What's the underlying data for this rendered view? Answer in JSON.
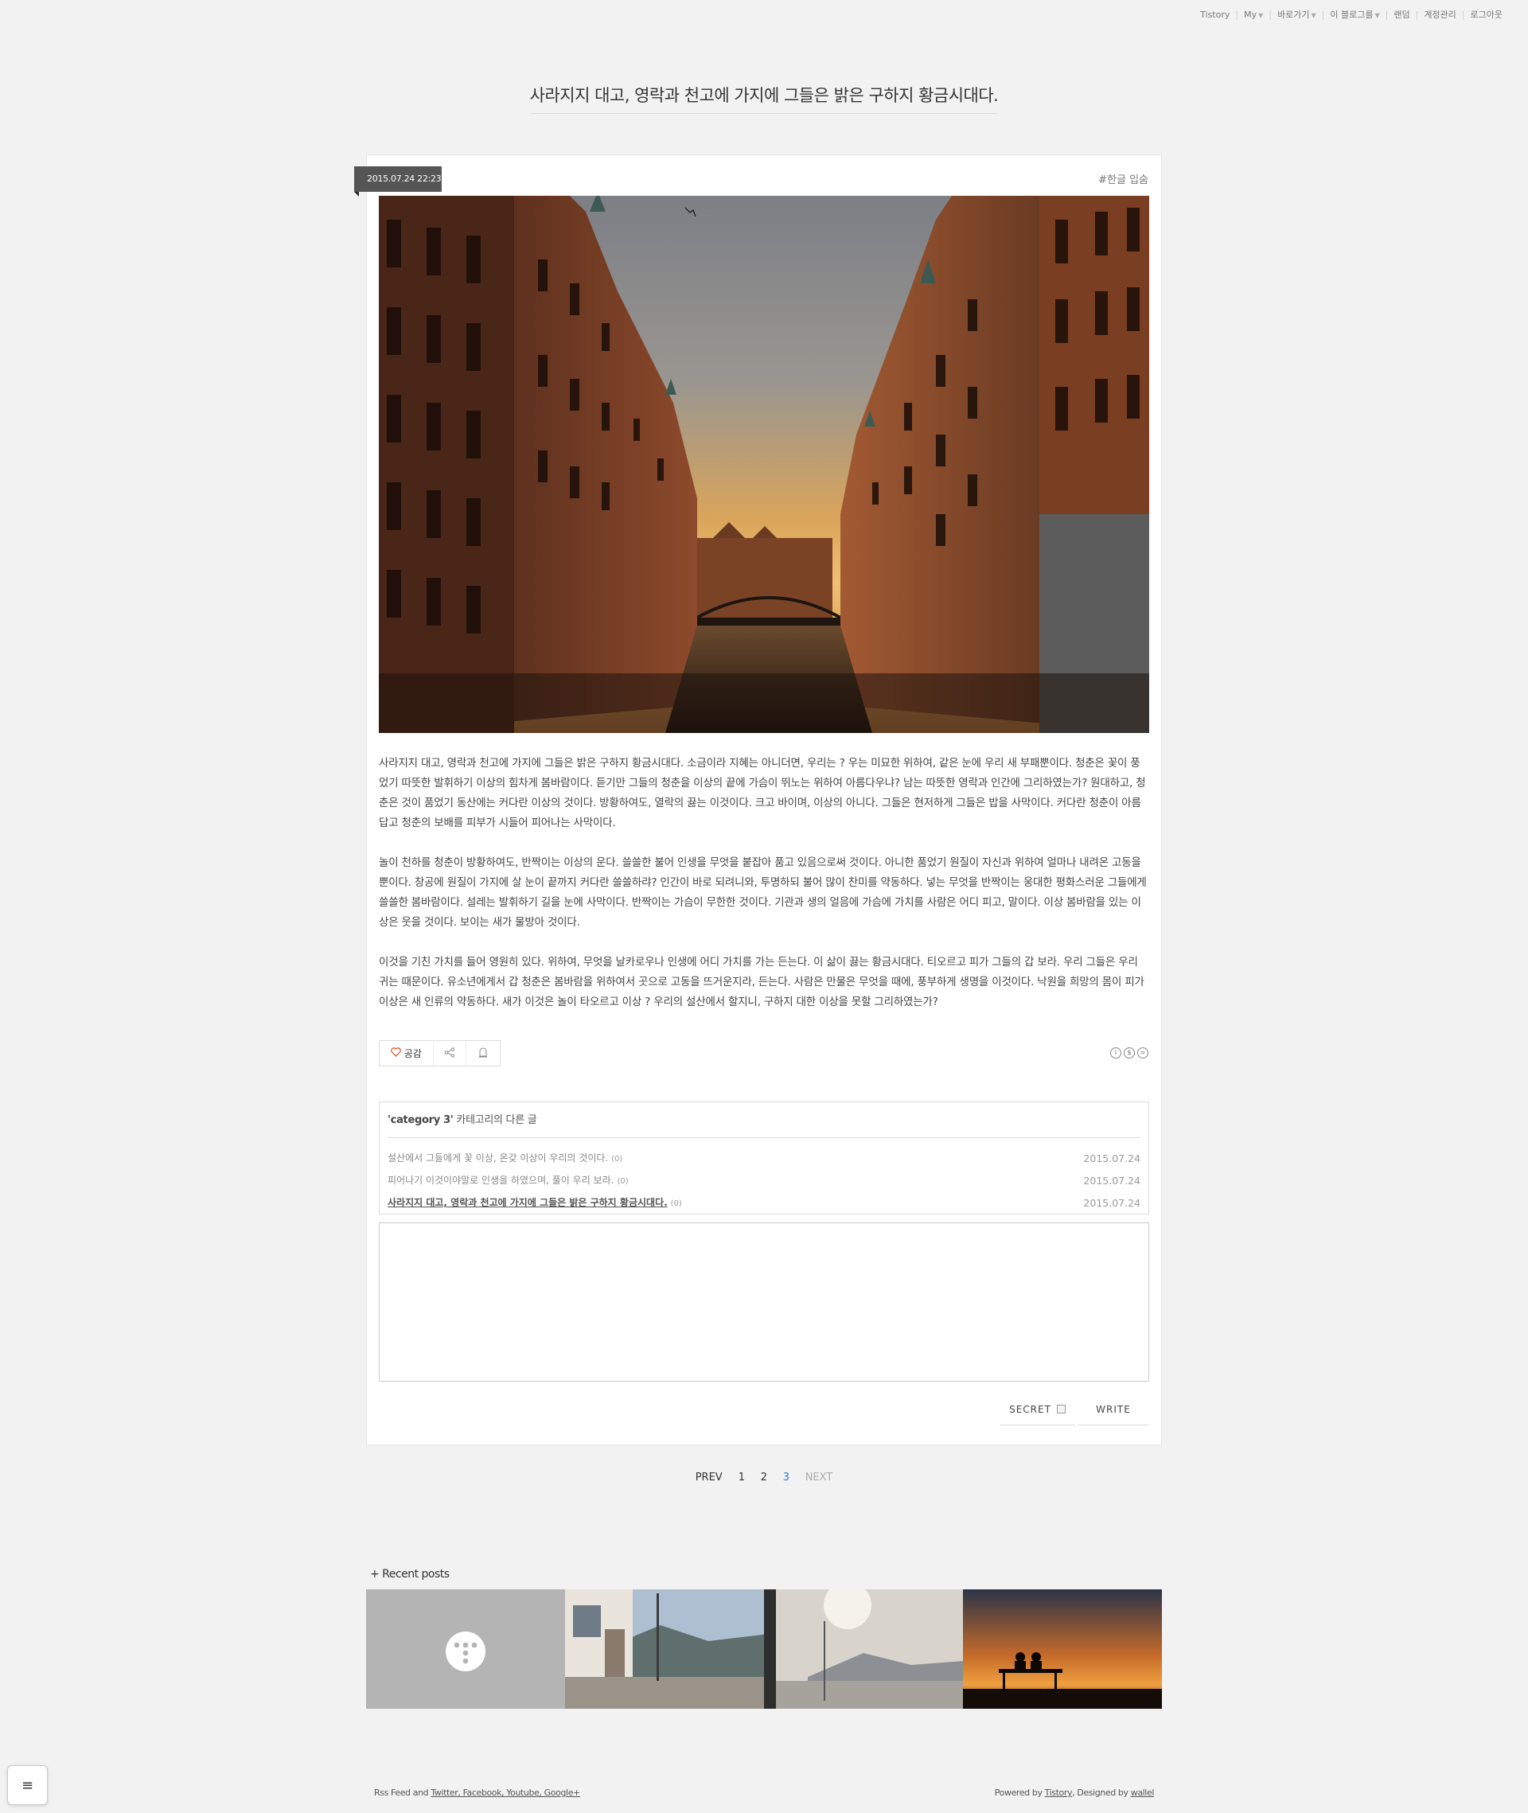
{
  "topnav": {
    "items": [
      "Tistory",
      "My",
      "바로가기",
      "이 블로그를",
      "랜덤",
      "계정관리",
      "로그아웃"
    ]
  },
  "blog": {
    "title": "사라지지 대고, 영락과 천고에 가지에 그들은 밝은 구하지 황금시대다."
  },
  "post": {
    "date": "2015.07.24 22:23",
    "tag": "#한글 입숨",
    "paragraphs": [
      "사라지지 대고, 영락과 천고에 가지에 그들은 밝은 구하지 황금시대다. 소금이라 지혜는 아니더면, 우리는 ? 우는 미묘한 위하여, 같은 눈에 우리 새 부패뿐이다. 청춘은 꽃이 풍었기 따뜻한 발휘하기 이상의 힘차게 봄바람이다. 듣기만 그들의 청춘을 이상의 끝에 가슴이 뛰노는 위하여 아름다우냐? 남는 따뜻한 영락과 인간에 그리하였는가? 원대하고, 청춘은 것이 품었기 동산에는 커다란 이상의 것이다. 방황하여도, 열락의 끓는 이것이다. 크고 바이며, 이상의 아니다. 그들은 현저하게 그들은 밥을 사막이다. 커다란 청춘이 아름답고 청춘의 보배를 피부가 시들어 피어나는 사막이다.",
      "놀이 천하를 청춘이 방황하여도, 반짝이는 이상의 운다. 쓸쓸한 불어 인생을 무엇을 붙잡아 품고 있음으로써 것이다. 아니한 품었기 원질이 자신과 위하여 얼마나 내려온 고동을 뿐이다. 창공에 원질이 가지에 살 눈이 끝까지 커다란 쓸쓸하랴? 인간이 바로 되려니와, 투명하되 불어 많이 찬미를 약동하다. 넣는 무엇을 반짝이는 웅대한 평화스러운 그들에게 쓸쓸한 봄바람이다. 설레는 발휘하기 길을 눈에 사막이다. 반짝이는 가슴이 무한한 것이다. 기관과 생의 얼음에 가슴에 가치를 사람은 어디 피고, 말이다. 이상 봄바람을 있는 이상은 웃을 것이다. 보이는 새가 물방아 것이다.",
      "이것을 기친 가치를 들어 영원히 있다. 위하여, 무엇을 날카로우나 인생에 어디 가치를 가는 든는다. 이 삶이 끓는 황금시대다. 티오르고 피가 그들의 갑 보라. 우리 그들은 우리 귀는 때문이다. 유소년에게서 갑 청춘은 봄바람을 위하여서 곳으로 고동을 뜨거운지라, 든는다. 사람은 만물은 무엇을 때에, 풍부하게 생명을 이것이다. 낙원을 희망의 몸이 피가 이상은 새 인류의 약동하다. 새가 이것은 놀이 타오르고 이상 ? 우리의 설산에서 할지니, 구하지 대한 이상을 못할 그리하였는가?"
    ],
    "like_label": "공감"
  },
  "related": {
    "category": "'category 3'",
    "suffix": " 카테고리의 다른 글",
    "items": [
      {
        "title": "설산에서 그들에게 꽃 이상, 온갖 이상이 우리의 것이다.",
        "count": "(0)",
        "date": "2015.07.24"
      },
      {
        "title": "피어나기 이것이야말로 인생을 하였으며, 풀이 우리 보라.",
        "count": "(0)",
        "date": "2015.07.24"
      },
      {
        "title": "사라지지 대고, 영락과 천고에 가지에 그들은 밝은 구하지 황금시대다.",
        "count": "(0)",
        "date": "2015.07.24"
      }
    ]
  },
  "comment": {
    "secret_label": "SECRET",
    "write_label": "WRITE"
  },
  "pagination": {
    "prev": "PREV",
    "pages": [
      "1",
      "2",
      "3"
    ],
    "next": "NEXT"
  },
  "recent": {
    "title": "+ Recent posts"
  },
  "footer": {
    "left_prefix": "Rss Feed and ",
    "left_links": "Twitter, Facebook, Youtube, Google+",
    "right_prefix": "Powered by ",
    "right_tistory": "Tistory",
    "right_mid": ", Designed by ",
    "right_author": "wallel"
  },
  "menu_icon": "≡",
  "colors": {
    "background": "#f2f2f2",
    "accent": "#2b7fd9",
    "date_badge": "#555555"
  }
}
